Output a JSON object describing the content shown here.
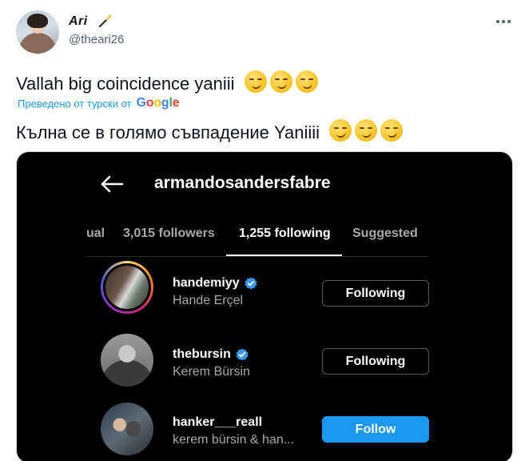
{
  "tweet": {
    "display_name": "Ari",
    "handle": "@theari26",
    "text_original": "Vallah big coincidence yaniii",
    "translated_label": "Преведено от турски от",
    "translation_provider": "Google",
    "text_translated": "Кълна се в голямо съвпадение Yaniiii",
    "emoji_name": "smirking-face",
    "emoji_count": 3
  },
  "instagram": {
    "username": "armandosandersfabre",
    "tabs": {
      "mutual_partial": "ual",
      "followers": "3,015 followers",
      "following": "1,255 following",
      "suggested": "Suggested"
    },
    "active_tab": "following",
    "rows": [
      {
        "username": "handemiyy",
        "full_name": "Hande Erçel",
        "verified": true,
        "button": "Following",
        "story_ring": true
      },
      {
        "username": "thebursin",
        "full_name": "Kerem Bürsin",
        "verified": true,
        "button": "Following",
        "story_ring": false
      },
      {
        "username": "hanker___reall",
        "full_name": "kerem bürsin & han...",
        "verified": false,
        "button": "Follow",
        "story_ring": false
      }
    ]
  },
  "colors": {
    "link_blue": "#1d9bf0",
    "secondary_text": "#536471",
    "ig_follow_blue": "#1c97ef",
    "ig_verified_blue": "#3897f0"
  }
}
